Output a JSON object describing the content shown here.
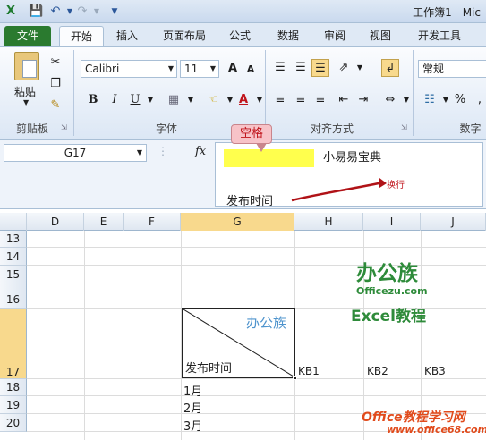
{
  "titlebar": {
    "title": "工作簿1 - Mic"
  },
  "tabs": [
    "文件",
    "开始",
    "插入",
    "页面布局",
    "公式",
    "数据",
    "审阅",
    "视图",
    "开发工具"
  ],
  "ribbon": {
    "paste_label": "粘贴",
    "font_name": "Calibri",
    "font_size": "11",
    "number_format": "常规",
    "groups": {
      "clipboard": "剪贴板",
      "font": "字体",
      "alignment": "对齐方式",
      "number": "数字"
    },
    "grow_font": "A",
    "shrink_font": "A",
    "bold": "B",
    "italic": "I",
    "underline": "U",
    "font_color": "A",
    "percent": "%"
  },
  "formula_bar": {
    "name_box": "G17",
    "fx": "fx",
    "line1": "小易易宝典",
    "line2": "发布时间"
  },
  "annotations": {
    "callout": "空格",
    "newline": "换行"
  },
  "grid": {
    "columns": [
      "D",
      "E",
      "F",
      "G",
      "H",
      "I",
      "J"
    ],
    "selected_column": "G",
    "rows": [
      "13",
      "14",
      "15",
      "16",
      "17",
      "18",
      "19",
      "20"
    ],
    "selected_row": "17",
    "g17_top": "办公族",
    "g17_bottom": "发布时间",
    "h17": "KB1",
    "i17": "KB2",
    "j17": "KB3",
    "g18": "1月",
    "g19": "2月",
    "g20": "3月"
  },
  "watermarks": {
    "logo_text": "办公族",
    "logo_sub": "Officezu.com",
    "logo_excel": "Excel教程",
    "site": "Office教程学习网",
    "site_url": "www.office68.com"
  },
  "colors": {
    "file_tab": "#2a7a2f",
    "selection": "#f8d98d",
    "callout_text": "#c0141b",
    "highlight": "#ffff4d"
  }
}
